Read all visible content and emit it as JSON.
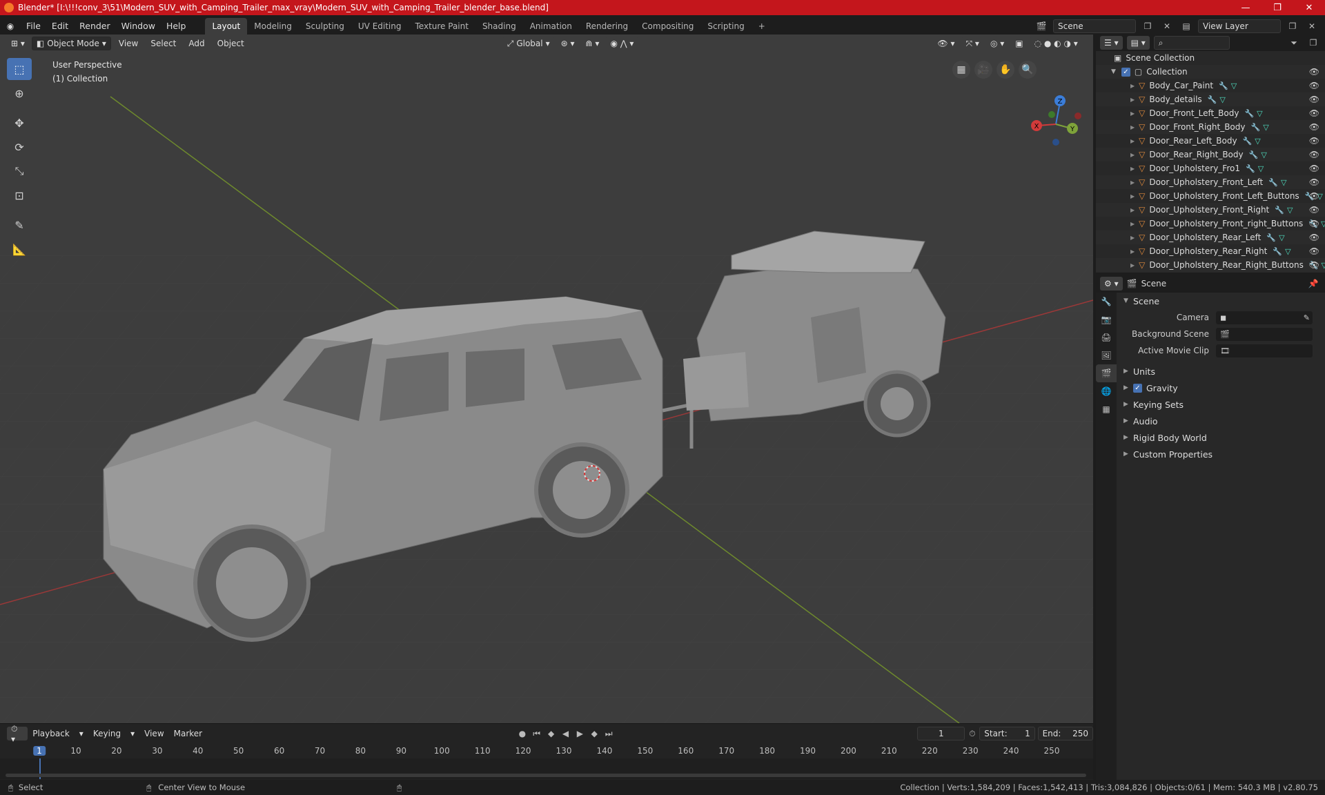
{
  "window": {
    "title": "Blender* [I:\\!!!conv_3\\51\\Modern_SUV_with_Camping_Trailer_max_vray\\Modern_SUV_with_Camping_Trailer_blender_base.blend]",
    "minimize": "—",
    "maximize": "❐",
    "close": "✕"
  },
  "menu": [
    "File",
    "Edit",
    "Render",
    "Window",
    "Help"
  ],
  "workspaces": [
    "Layout",
    "Modeling",
    "Sculpting",
    "UV Editing",
    "Texture Paint",
    "Shading",
    "Animation",
    "Rendering",
    "Compositing",
    "Scripting"
  ],
  "workspace_add": "+",
  "active_workspace": "Layout",
  "scene_field": "Scene",
  "view_layer_field": "View Layer",
  "viewport": {
    "mode": "Object Mode",
    "menus": [
      "View",
      "Select",
      "Add",
      "Object"
    ],
    "orientation": "Global",
    "info_line1": "User Perspective",
    "info_line2": "(1) Collection",
    "gizmo": {
      "x": "X",
      "y": "Y",
      "z": "Z"
    }
  },
  "timeline": {
    "menus": [
      "Playback",
      "Keying",
      "View",
      "Marker"
    ],
    "current_frame": "1",
    "start_label": "Start:",
    "start": "1",
    "end_label": "End:",
    "end": "250",
    "ruler": [
      "1",
      "10",
      "20",
      "30",
      "40",
      "50",
      "60",
      "70",
      "80",
      "90",
      "100",
      "110",
      "120",
      "130",
      "140",
      "150",
      "160",
      "170",
      "180",
      "190",
      "200",
      "210",
      "220",
      "230",
      "240",
      "250"
    ]
  },
  "status": {
    "select": "Select",
    "center": "Center View to Mouse",
    "stats": "Collection | Verts:1,584,209 | Faces:1,542,413 | Tris:3,084,826 | Objects:0/61 | Mem: 540.3 MB | v2.80.75"
  },
  "outliner": {
    "root": "Scene Collection",
    "collection": "Collection",
    "items": [
      "Body_Car_Paint",
      "Body_details",
      "Door_Front_Left_Body",
      "Door_Front_Right_Body",
      "Door_Rear_Left_Body",
      "Door_Rear_Right_Body",
      "Door_Upholstery_Fro1",
      "Door_Upholstery_Front_Left",
      "Door_Upholstery_Front_Left_Buttons",
      "Door_Upholstery_Front_Right",
      "Door_Upholstery_Front_right_Buttons",
      "Door_Upholstery_Rear_Left",
      "Door_Upholstery_Rear_Right",
      "Door_Upholstery_Rear_Right_Buttons"
    ]
  },
  "properties": {
    "context": "Scene",
    "panel": "Scene",
    "fields": [
      {
        "label": "Camera",
        "value": ""
      },
      {
        "label": "Background Scene",
        "value": ""
      },
      {
        "label": "Active Movie Clip",
        "value": ""
      }
    ],
    "subpanels": [
      "Units",
      "Gravity",
      "Keying Sets",
      "Audio",
      "Rigid Body World",
      "Custom Properties"
    ]
  },
  "colors": {
    "title_bar": "#c4161c",
    "accent": "#4772b3",
    "viewport_bg": "#3d3d3d",
    "x_axis": "#c43a3a",
    "y_axis": "#7ea33a",
    "object_icon": "#e08a3c"
  }
}
